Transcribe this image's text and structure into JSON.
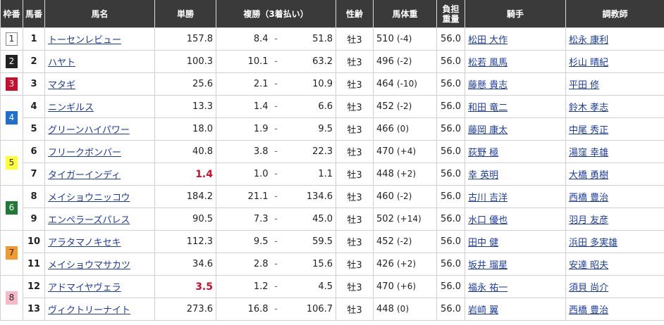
{
  "headers": {
    "waku": "枠番",
    "umaban": "馬番",
    "name": "馬名",
    "win": "単勝",
    "place": "複勝（3着払い）",
    "sexage": "性齢",
    "weight": "馬体重",
    "burden": "負担重量",
    "jockey": "騎手",
    "trainer": "調教師"
  },
  "waku_groups": [
    {
      "no": "1",
      "bg": "#ffffff",
      "fg": "#222222",
      "rows": 1
    },
    {
      "no": "2",
      "bg": "#222222",
      "fg": "#ffffff",
      "rows": 1
    },
    {
      "no": "3",
      "bg": "#c8102e",
      "fg": "#ffffff",
      "rows": 1
    },
    {
      "no": "4",
      "bg": "#1f6fd0",
      "fg": "#ffffff",
      "rows": 2
    },
    {
      "no": "5",
      "bg": "#ffff33",
      "fg": "#222222",
      "rows": 2
    },
    {
      "no": "6",
      "bg": "#1f7a34",
      "fg": "#ffffff",
      "rows": 2
    },
    {
      "no": "7",
      "bg": "#f39a2c",
      "fg": "#222222",
      "rows": 2
    },
    {
      "no": "8",
      "bg": "#f7b8c8",
      "fg": "#222222",
      "rows": 2
    }
  ],
  "horses": [
    {
      "no": "1",
      "name": "トーセンレビュー",
      "win": "157.8",
      "fav": false,
      "place_min": "8.4",
      "place_max": "51.8",
      "sexage": "牡3",
      "weight": "510",
      "diff": "(-4)",
      "burden": "56.0",
      "jockey": "松田 大作",
      "trainer": "松永 康利"
    },
    {
      "no": "2",
      "name": "ハヤト",
      "win": "100.3",
      "fav": false,
      "place_min": "10.1",
      "place_max": "63.2",
      "sexage": "牡3",
      "weight": "496",
      "diff": "(-2)",
      "burden": "56.0",
      "jockey": "松若 風馬",
      "trainer": "杉山 晴紀"
    },
    {
      "no": "3",
      "name": "マタギ",
      "win": "25.6",
      "fav": false,
      "place_min": "2.1",
      "place_max": "10.9",
      "sexage": "牡3",
      "weight": "464",
      "diff": "(-10)",
      "burden": "56.0",
      "jockey": "藤懸 貴志",
      "trainer": "平田 修"
    },
    {
      "no": "4",
      "name": "ニンギルス",
      "win": "13.3",
      "fav": false,
      "place_min": "1.4",
      "place_max": "6.6",
      "sexage": "牡3",
      "weight": "452",
      "diff": "(-2)",
      "burden": "56.0",
      "jockey": "和田 竜二",
      "trainer": "鈴木 孝志"
    },
    {
      "no": "5",
      "name": "グリーンハイパワー",
      "win": "18.0",
      "fav": false,
      "place_min": "1.9",
      "place_max": "9.5",
      "sexage": "牡3",
      "weight": "466",
      "diff": "(0)",
      "burden": "56.0",
      "jockey": "藤岡 康太",
      "trainer": "中尾 秀正"
    },
    {
      "no": "6",
      "name": "フリークボンバー",
      "win": "40.8",
      "fav": false,
      "place_min": "3.8",
      "place_max": "22.3",
      "sexage": "牡3",
      "weight": "470",
      "diff": "(+4)",
      "burden": "56.0",
      "jockey": "荻野 極",
      "trainer": "湯窪 幸雄"
    },
    {
      "no": "7",
      "name": "タイガーインディ",
      "win": "1.4",
      "fav": true,
      "place_min": "1.0",
      "place_max": "1.1",
      "sexage": "牡3",
      "weight": "448",
      "diff": "(+2)",
      "burden": "56.0",
      "jockey": "幸 英明",
      "trainer": "大橋 勇樹"
    },
    {
      "no": "8",
      "name": "メイショウニッコウ",
      "win": "184.2",
      "fav": false,
      "place_min": "21.1",
      "place_max": "134.6",
      "sexage": "牡3",
      "weight": "460",
      "diff": "(-2)",
      "burden": "56.0",
      "jockey": "古川 吉洋",
      "trainer": "西橋 豊治"
    },
    {
      "no": "9",
      "name": "エンペラーズパレス",
      "win": "90.5",
      "fav": false,
      "place_min": "7.3",
      "place_max": "45.0",
      "sexage": "牡3",
      "weight": "502",
      "diff": "(+14)",
      "burden": "56.0",
      "jockey": "水口 優也",
      "trainer": "羽月 友彦"
    },
    {
      "no": "10",
      "name": "アラタマノキセキ",
      "win": "112.3",
      "fav": false,
      "place_min": "9.5",
      "place_max": "59.5",
      "sexage": "牡3",
      "weight": "452",
      "diff": "(-2)",
      "burden": "56.0",
      "jockey": "田中 健",
      "trainer": "浜田 多実雄"
    },
    {
      "no": "11",
      "name": "メイショウマサカツ",
      "win": "34.6",
      "fav": false,
      "place_min": "2.8",
      "place_max": "15.6",
      "sexage": "牡3",
      "weight": "426",
      "diff": "(+2)",
      "burden": "56.0",
      "jockey": "坂井 瑠星",
      "trainer": "安達 昭夫"
    },
    {
      "no": "12",
      "name": "アドマイヤヴェラ",
      "win": "3.5",
      "fav": true,
      "place_min": "1.2",
      "place_max": "4.5",
      "sexage": "牡3",
      "weight": "470",
      "diff": "(+6)",
      "burden": "56.0",
      "jockey": "福永 祐一",
      "trainer": "須貝 尚介"
    },
    {
      "no": "13",
      "name": "ヴィクトリーナイト",
      "win": "273.6",
      "fav": false,
      "place_min": "16.8",
      "place_max": "106.7",
      "sexage": "牡3",
      "weight": "448",
      "diff": "(0)",
      "burden": "56.0",
      "jockey": "岩崎 翼",
      "trainer": "西橋 豊治"
    }
  ]
}
